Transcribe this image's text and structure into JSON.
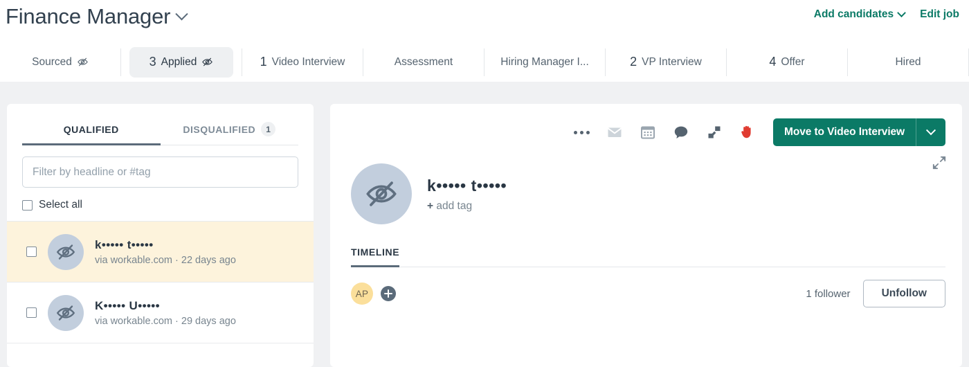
{
  "header": {
    "job_title": "Finance Manager",
    "title_chevron_icon": "chevron-down-icon",
    "add_candidates_label": "Add candidates",
    "edit_job_label": "Edit job",
    "accent_color": "#0b7a66"
  },
  "stages": [
    {
      "count": "",
      "label": "Sourced",
      "anonymized": true,
      "active": false
    },
    {
      "count": "3",
      "label": "Applied",
      "anonymized": true,
      "active": true
    },
    {
      "count": "1",
      "label": "Video Interview",
      "anonymized": false,
      "active": false
    },
    {
      "count": "",
      "label": "Assessment",
      "anonymized": false,
      "active": false
    },
    {
      "count": "",
      "label": "Hiring Manager I...",
      "anonymized": false,
      "active": false,
      "truncated": true
    },
    {
      "count": "2",
      "label": "VP Interview",
      "anonymized": false,
      "active": false
    },
    {
      "count": "4",
      "label": "Offer",
      "anonymized": false,
      "active": false
    },
    {
      "count": "",
      "label": "Hired",
      "anonymized": false,
      "active": false
    }
  ],
  "left_panel": {
    "tabs": [
      {
        "label": "QUALIFIED",
        "badge": "",
        "active": true
      },
      {
        "label": "DISQUALIFIED",
        "badge": "1",
        "active": false
      }
    ],
    "filter": {
      "value": "",
      "placeholder": "Filter by headline or #tag"
    },
    "select_all_label": "Select all",
    "candidates": [
      {
        "name": "k••••• t•••••",
        "meta": "via workable.com · 22 days ago",
        "avatar_icon": "eye-off-icon",
        "selected": true,
        "highlight_color": "#fdf3dc"
      },
      {
        "name": "K••••• U•••••",
        "meta": "via workable.com · 29 days ago",
        "avatar_icon": "eye-off-icon",
        "selected": false
      }
    ]
  },
  "right_panel": {
    "toolbar_icons": [
      "more-options-icon",
      "email-icon",
      "calendar-icon",
      "comment-icon",
      "disqualify-icon",
      "stop-hand-icon"
    ],
    "move_button": {
      "label": "Move to Video Interview",
      "chevron_icon": "chevron-down-icon",
      "color": "#0b7a66"
    },
    "candidate": {
      "name": "k••••• t•••••",
      "add_tag_plus": "+",
      "add_tag_label": "add tag",
      "avatar_icon": "eye-off-icon",
      "expand_icon": "expand-icon"
    },
    "timeline": {
      "tab_label": "TIMELINE",
      "participant_initials": "AP",
      "add_participant_icon": "plus-circle-icon",
      "follower_count_label": "1 follower",
      "unfollow_label": "Unfollow"
    }
  }
}
